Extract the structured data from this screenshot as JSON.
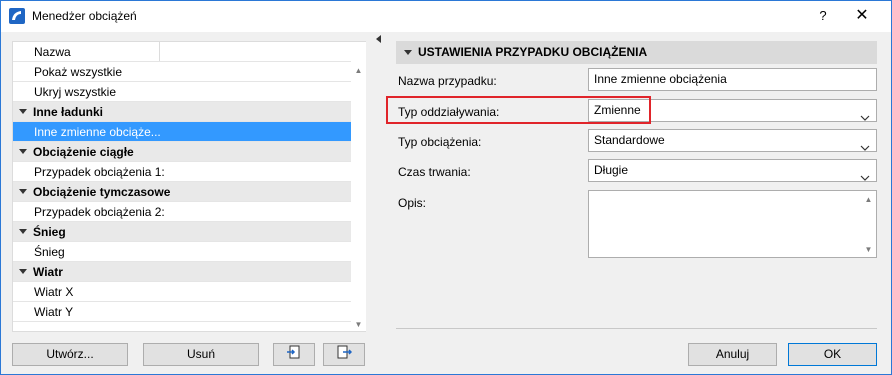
{
  "window": {
    "title": "Menedżer obciążeń",
    "help_label": "?",
    "close_label": "✕"
  },
  "list": {
    "column_header": "Nazwa",
    "rows": [
      {
        "type": "item",
        "label": "Pokaż wszystkie"
      },
      {
        "type": "item",
        "label": "Ukryj wszystkie"
      },
      {
        "type": "group",
        "label": "Inne ładunki"
      },
      {
        "type": "item",
        "label": "Inne zmienne obciąże...",
        "selected": true
      },
      {
        "type": "group",
        "label": "Obciążenie ciągłe"
      },
      {
        "type": "item",
        "label": "Przypadek obciążenia 1:"
      },
      {
        "type": "group",
        "label": "Obciążenie tymczasowe"
      },
      {
        "type": "item",
        "label": "Przypadek obciążenia 2:"
      },
      {
        "type": "group",
        "label": "Śnieg"
      },
      {
        "type": "item",
        "label": "Śnieg"
      },
      {
        "type": "group",
        "label": "Wiatr"
      },
      {
        "type": "item",
        "label": "Wiatr X"
      },
      {
        "type": "item",
        "label": "Wiatr Y"
      }
    ]
  },
  "left_buttons": {
    "create": "Utwórz...",
    "delete": "Usuń"
  },
  "section": {
    "title": "USTAWIENIA PRZYPADKU OBCIĄŻENIA"
  },
  "fields": {
    "case_name_label": "Nazwa przypadku:",
    "case_name_value": "Inne zmienne obciążenia",
    "interaction_type_label": "Typ oddziaływania:",
    "interaction_type_value": "Zmienne",
    "load_type_label": "Typ obciążenia:",
    "load_type_value": "Standardowe",
    "duration_label": "Czas trwania:",
    "duration_value": "Długie",
    "description_label": "Opis:",
    "description_value": ""
  },
  "dialog_buttons": {
    "cancel": "Anuluj",
    "ok": "OK"
  },
  "colors": {
    "accent": "#3399ff",
    "highlight_frame": "#e0242a",
    "window_border": "#2b78d6"
  }
}
